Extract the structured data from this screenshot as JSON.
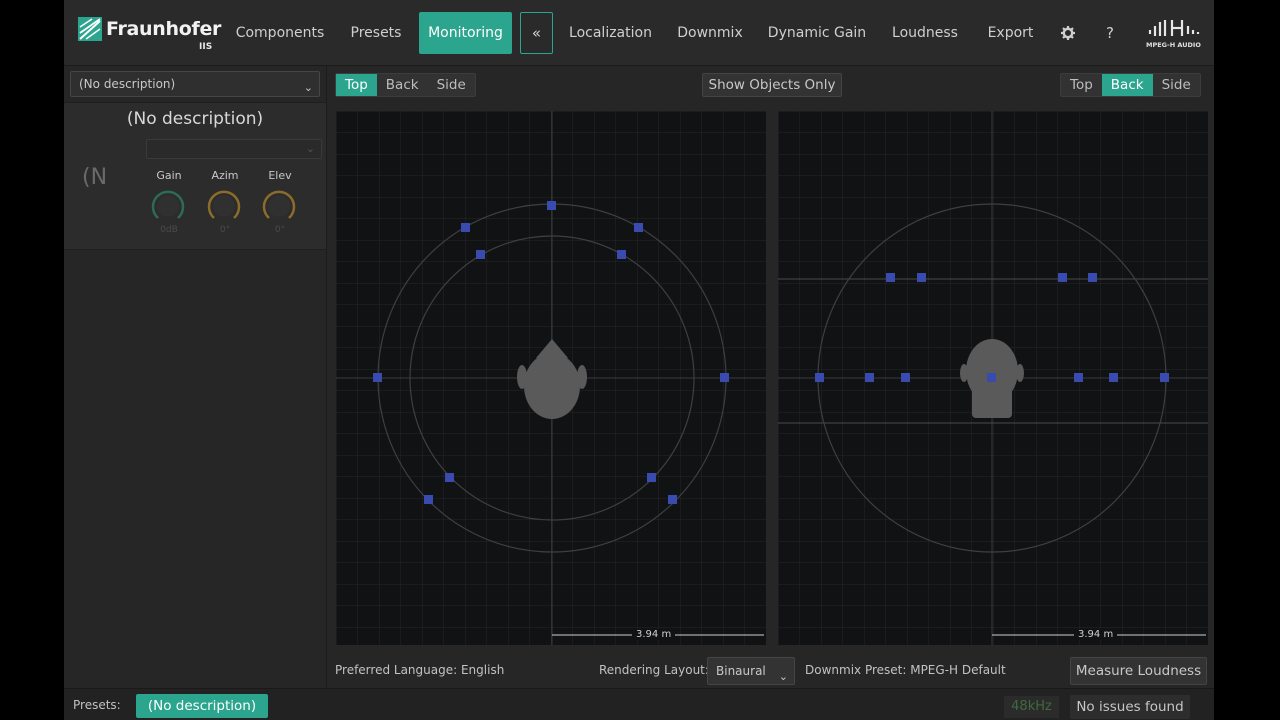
{
  "app": {
    "brand": "Fraunhofer",
    "brand_sub": "IIS",
    "product_logo_text": "MPEG-H AUDIO"
  },
  "nav": {
    "items": [
      "Components",
      "Presets",
      "Monitoring",
      "Localization",
      "Downmix",
      "Dynamic Gain",
      "Loudness",
      "Export"
    ],
    "active": "Monitoring",
    "collapse_symbol": "«",
    "settings_icon": "gear-icon",
    "help_symbol": "?"
  },
  "left_panel": {
    "component_select": "(No description)",
    "card_title": "(No description)",
    "card_icon_text": "(N",
    "knobs": [
      {
        "label": "Gain",
        "value": "0dB",
        "color": "#2c6a5a"
      },
      {
        "label": "Azim",
        "value": "0°",
        "color": "#8a6d2a"
      },
      {
        "label": "Elev",
        "value": "0°",
        "color": "#8a6d2a"
      }
    ]
  },
  "viewer": {
    "left_views": [
      "Top",
      "Back",
      "Side"
    ],
    "left_active": "Top",
    "right_views": [
      "Top",
      "Back",
      "Side"
    ],
    "right_active": "Back",
    "show_objects_only": "Show Objects Only",
    "scale_left": "3.94 m",
    "scale_right": "3.94 m",
    "accent_color": "#2ba58e",
    "speaker_color": "#3a4bb0"
  },
  "bottom_bar": {
    "preferred_language": "Preferred Language: English",
    "rendering_layout_label": "Rendering Layout:",
    "rendering_layout_value": "Binaural",
    "downmix_preset": "Downmix Preset: MPEG-H Default",
    "measure_loudness": "Measure Loudness"
  },
  "status_bar": {
    "presets_label": "Presets:",
    "presets_value": "(No description)",
    "sample_rate": "48kHz",
    "issues": "No issues found"
  }
}
